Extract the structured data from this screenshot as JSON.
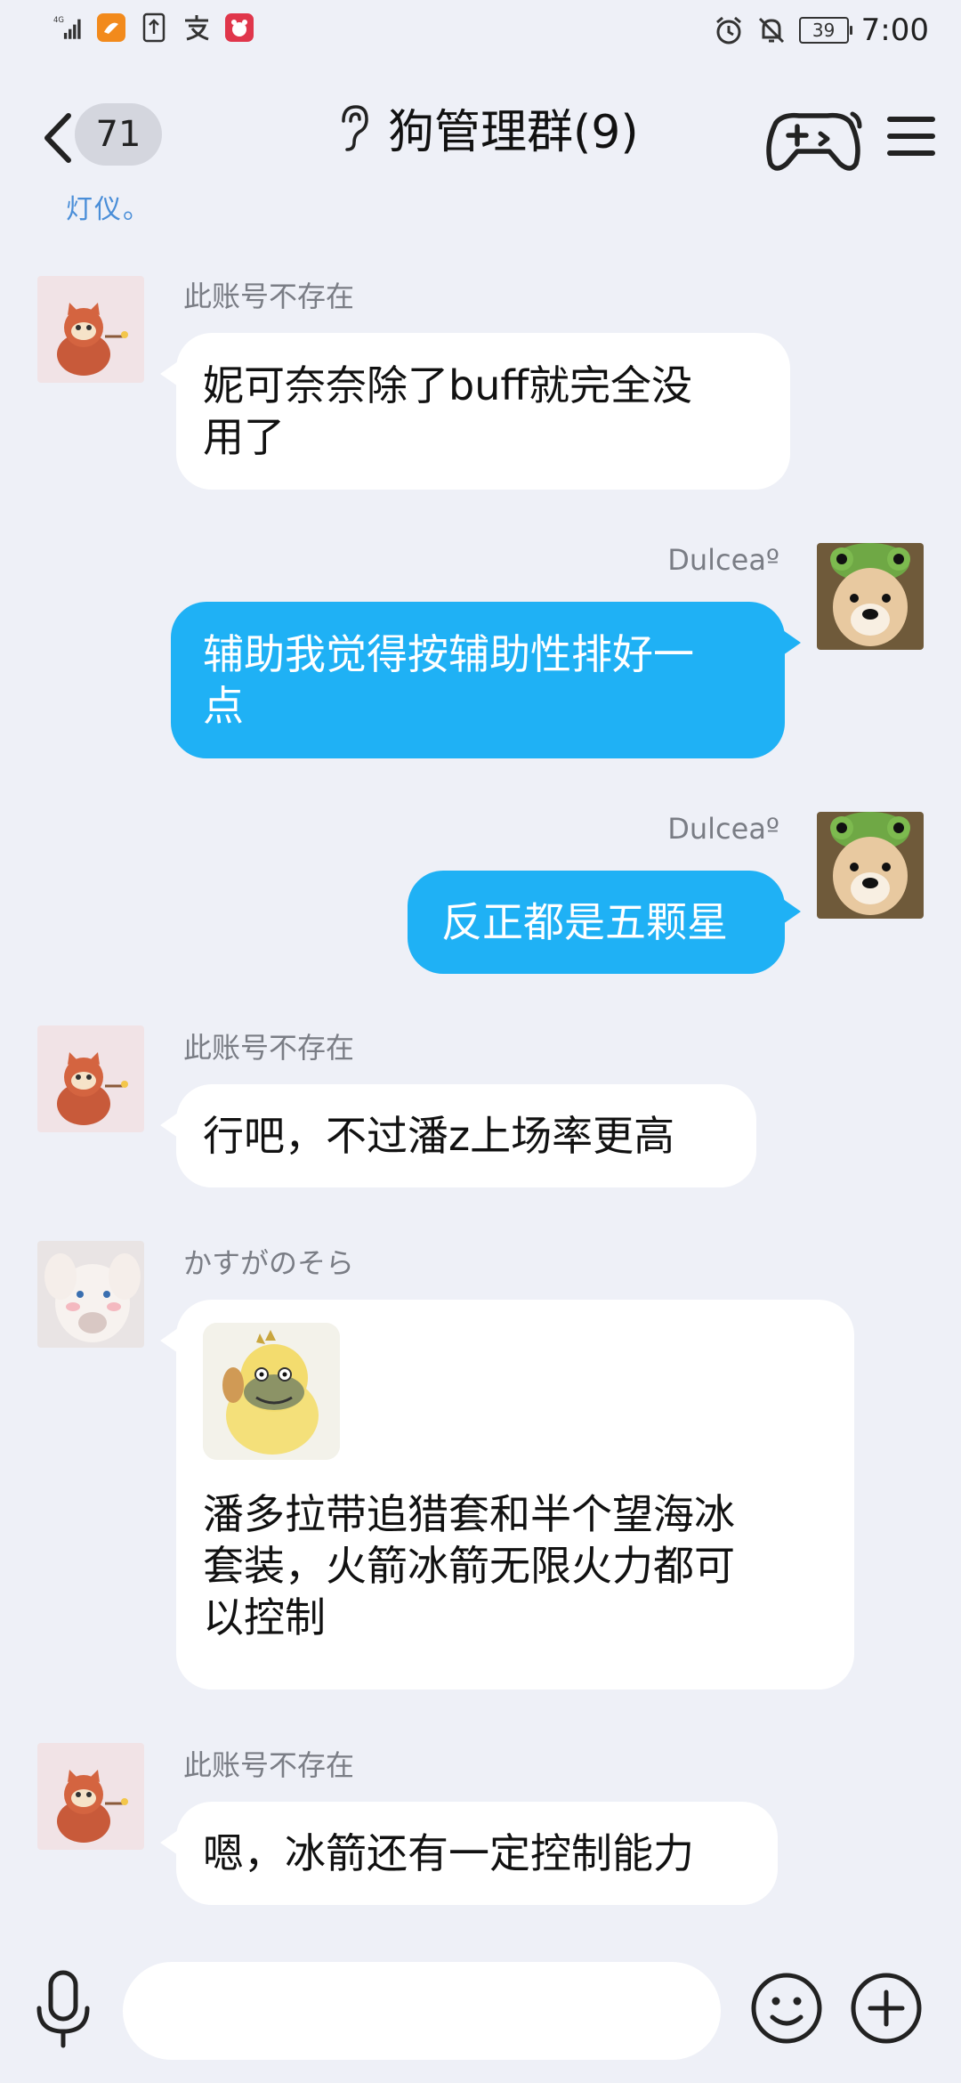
{
  "status_bar": {
    "network": "4G",
    "battery": "39",
    "time": "7:00",
    "icons": [
      "signal-icon",
      "app-notification-icon",
      "upload-icon",
      "alipay-icon",
      "app-badge-icon",
      "alarm-icon",
      "mute-icon",
      "battery-icon"
    ]
  },
  "header": {
    "back_icon": "chevron-left-icon",
    "unread_count": "71",
    "title": "狗管理群(9)",
    "ear_icon": "ear-icon",
    "game_icon": "gamepad-icon",
    "menu_icon": "menu-icon"
  },
  "partial_text": "灯仪。",
  "messages": [
    {
      "side": "in",
      "sender": "此账号不存在",
      "avatar": "cat-avatar",
      "text": [
        "妮可奈奈除了buff就完全没",
        "用了"
      ]
    },
    {
      "side": "out",
      "sender": "Dulceaº",
      "avatar": "dog-avatar",
      "text": [
        "辅助我觉得按辅助性排好一",
        "点"
      ]
    },
    {
      "side": "out",
      "sender": "Dulceaº",
      "avatar": "dog-avatar",
      "text": [
        "反正都是五颗星"
      ]
    },
    {
      "side": "in",
      "sender": "此账号不存在",
      "avatar": "cat-avatar",
      "text": [
        "行吧，不过潘z上场率更高"
      ]
    },
    {
      "side": "in",
      "sender": "かすがのそら",
      "avatar": "plush-avatar",
      "sticker": "duck-sticker",
      "text": [
        "潘多拉带追猎套和半个望海冰",
        "套装，火箭冰箭无限火力都可",
        "以控制"
      ]
    },
    {
      "side": "in",
      "sender": "此账号不存在",
      "avatar": "cat-avatar",
      "text": [
        "嗯，冰箭还有一定控制能力"
      ]
    }
  ],
  "input_bar": {
    "placeholder": "",
    "mic_icon": "microphone-icon",
    "emoji_icon": "emoji-icon",
    "plus_icon": "plus-icon"
  },
  "colors": {
    "background": "#eef0f7",
    "outgoing_bubble": "#1fb1f5",
    "incoming_bubble": "#ffffff",
    "sender_name": "#7a7d85"
  }
}
